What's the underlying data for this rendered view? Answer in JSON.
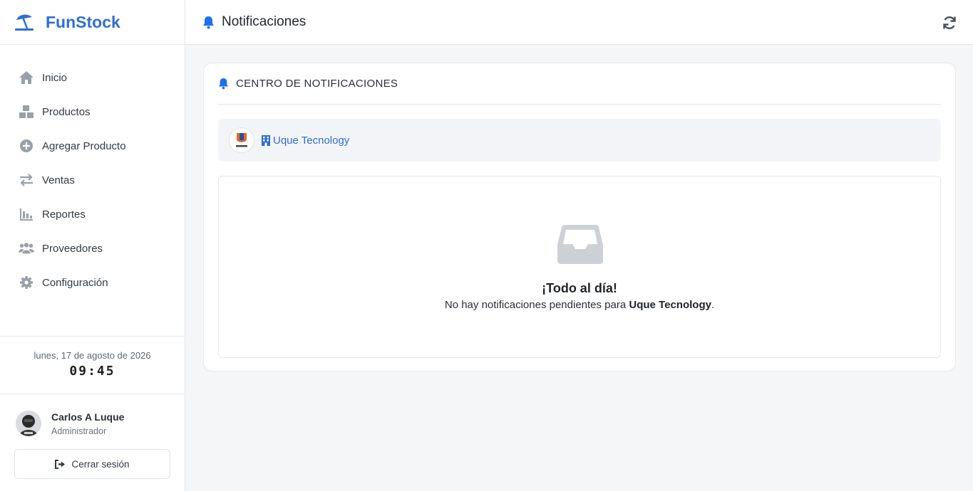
{
  "brand": {
    "name": "FunStock",
    "color": "#2f6fd6"
  },
  "sidebar": {
    "items": [
      {
        "label": "Inicio",
        "icon": "home-icon"
      },
      {
        "label": "Productos",
        "icon": "boxes-icon"
      },
      {
        "label": "Agregar Producto",
        "icon": "plus-circle-icon"
      },
      {
        "label": "Ventas",
        "icon": "exchange-icon"
      },
      {
        "label": "Reportes",
        "icon": "bar-chart-icon"
      },
      {
        "label": "Proveedores",
        "icon": "users-icon"
      },
      {
        "label": "Configuración",
        "icon": "gear-icon"
      }
    ]
  },
  "clock": {
    "date": "lunes, 17 de agosto de 2026",
    "time": "09:45"
  },
  "user": {
    "name": "Carlos A Luque",
    "role": "Administrador"
  },
  "logout": {
    "label": "Cerrar sesión"
  },
  "header": {
    "title": "Notificaciones"
  },
  "card": {
    "title": "CENTRO DE NOTIFICACIONES",
    "company": "Uque Tecnology",
    "empty_title": "¡Todo al día!",
    "empty_text_prefix": "No hay notificaciones pendientes para ",
    "empty_text_company": "Uque Tecnology",
    "empty_text_suffix": "."
  },
  "colors": {
    "accent": "#2f6fd6",
    "bell": "#1e6ff0",
    "icon_gray": "#9aa0a8"
  }
}
